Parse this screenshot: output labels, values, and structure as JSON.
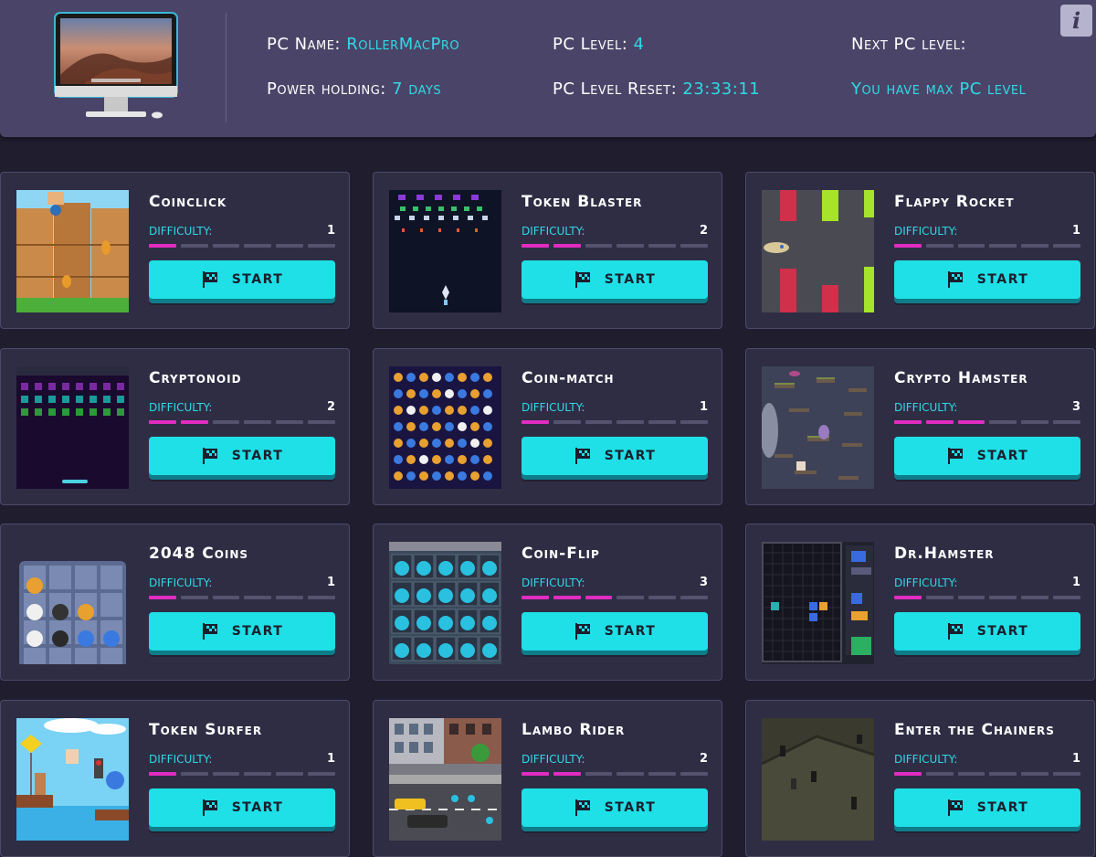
{
  "header": {
    "pc_name_label": "PC Name:",
    "pc_name_value": "RollerMacPro",
    "power_label": "Power holding:",
    "power_value": "7 days",
    "pc_level_label": "PC Level:",
    "pc_level_value": "4",
    "reset_label": "PC Level Reset:",
    "reset_value": "23:33:11",
    "next_level_label": "Next PC level:",
    "next_level_value": "You have max PC level",
    "info_button": "i"
  },
  "difficulty_label": "DIFFICULTY:",
  "difficulty_max": 6,
  "start_label": "START",
  "games": [
    {
      "title": "Coinclick",
      "difficulty": 1
    },
    {
      "title": "Token Blaster",
      "difficulty": 2
    },
    {
      "title": "Flappy Rocket",
      "difficulty": 1
    },
    {
      "title": "Cryptonoid",
      "difficulty": 2
    },
    {
      "title": "Coin-match",
      "difficulty": 1
    },
    {
      "title": "Crypto Hamster",
      "difficulty": 3
    },
    {
      "title": "2048 Coins",
      "difficulty": 1
    },
    {
      "title": "Coin-Flip",
      "difficulty": 3
    },
    {
      "title": "Dr.Hamster",
      "difficulty": 1
    },
    {
      "title": "Token Surfer",
      "difficulty": 1
    },
    {
      "title": "Lambo Rider",
      "difficulty": 2
    },
    {
      "title": "Enter the Chainers",
      "difficulty": 1
    }
  ],
  "colors": {
    "accent": "#1ee0e6",
    "value_text": "#2fd9e6",
    "difficulty_on": "#e12cc1",
    "difficulty_off": "#56516f",
    "card_bg": "#2f2d44",
    "header_bg": "#4a4568"
  },
  "icons": {
    "start": "checkered-flag-icon",
    "info": "info-icon",
    "pc": "computer-monitor-icon"
  }
}
